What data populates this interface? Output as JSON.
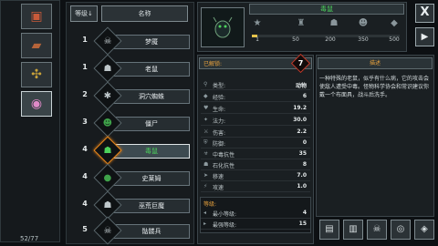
{
  "categories": [
    {
      "icon": "chest-icon",
      "glyph": "▣",
      "color": "#c85a3a"
    },
    {
      "icon": "boot-icon",
      "glyph": "▰",
      "color": "#b5643a"
    },
    {
      "icon": "creature-icon",
      "glyph": "✣",
      "color": "#c9a23a"
    },
    {
      "icon": "eye-icon",
      "glyph": "◉",
      "color": "#e08ac8"
    }
  ],
  "counter": "52/77",
  "list": {
    "sort_label": "等级↓",
    "name_header": "名称",
    "rows": [
      {
        "num": "1",
        "name": "梦魇",
        "glyph": "☠",
        "color": "#bfc8cb"
      },
      {
        "num": "1",
        "name": "老鼠",
        "glyph": "☗",
        "color": "#bfc8cb"
      },
      {
        "num": "2",
        "name": "洞穴蜘蛛",
        "glyph": "✱",
        "color": "#bfc8cb"
      },
      {
        "num": "3",
        "name": "僵尸",
        "glyph": "☻",
        "color": "#3fa34a"
      },
      {
        "num": "4",
        "name": "毒鼠",
        "glyph": "☗",
        "color": "#4dd25c"
      },
      {
        "num": "4",
        "name": "史莱姆",
        "glyph": "●",
        "color": "#3fa34a"
      },
      {
        "num": "4",
        "name": "巫荒巨魔",
        "glyph": "☗",
        "color": "#bfc8cb"
      },
      {
        "num": "5",
        "name": "骷髅兵",
        "glyph": "☠",
        "color": "#bfc8cb"
      }
    ]
  },
  "detail": {
    "title": "毒鼠",
    "progress_labels": [
      "1",
      "50",
      "200",
      "350",
      "500"
    ],
    "progress_fraction": 0.04,
    "level_label": "已解锁:",
    "level_value": "7",
    "stat_header_label": "类型:",
    "stat_header_value": "动物",
    "stats": [
      {
        "icon": "◆",
        "label": "经验:",
        "value": "6"
      },
      {
        "icon": "♥",
        "label": "生命:",
        "value": "19.2"
      },
      {
        "icon": "✦",
        "label": "法力:",
        "value": "30.0"
      },
      {
        "icon": "⚔",
        "label": "伤害:",
        "value": "2.2"
      },
      {
        "icon": "⛨",
        "label": "防御:",
        "value": "0"
      },
      {
        "icon": "☣",
        "label": "中毒抗性",
        "value": "35"
      },
      {
        "icon": "☗",
        "label": "石化抗性",
        "value": "8"
      },
      {
        "icon": "➤",
        "label": "移速",
        "value": "7.0"
      },
      {
        "icon": "⚡",
        "label": "攻速",
        "value": "1.0"
      }
    ],
    "sub_title": "等级:",
    "sub_stats": [
      {
        "label": "最小等级:",
        "value": "4"
      },
      {
        "label": "最强等级:",
        "value": "15"
      }
    ],
    "desc_header": "描述",
    "description": "一种特殊的老鼠，似乎有什么病，它的攻击会使敌人遭受中毒。怪物科学协会和常识建议你戴一个布面具，战斗后洗手。"
  },
  "toolbar": [
    {
      "icon": "book-icon",
      "glyph": "▤"
    },
    {
      "icon": "scroll-icon",
      "glyph": "▥"
    },
    {
      "icon": "skull-icon",
      "glyph": "☠"
    },
    {
      "icon": "mask-icon",
      "glyph": "◎"
    },
    {
      "icon": "gem-icon",
      "glyph": "◈"
    }
  ],
  "buttons": {
    "close": "X",
    "play": "▶"
  }
}
